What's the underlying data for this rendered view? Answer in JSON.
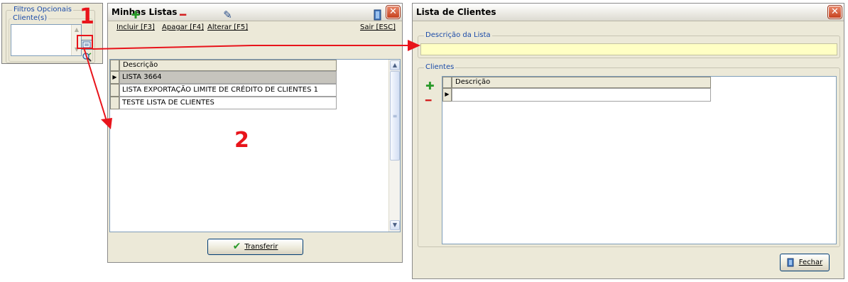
{
  "filter_panel": {
    "group_title": "Filtros Opcionais",
    "clients_label": "Cliente(s)"
  },
  "markers": {
    "one": "1",
    "two": "2"
  },
  "minhas_listas": {
    "title": "Minhas Listas",
    "toolbar": {
      "incluir": "Incluir [F3]",
      "apagar": "Apagar [F4]",
      "alterar": "Alterar [F5]",
      "sair": "Sair [ESC]"
    },
    "grid_header": "Descrição",
    "rows": [
      "LISTA 3664",
      "LISTA EXPORTAÇÃO LIMITE DE CRÉDITO DE CLIENTES 1",
      "TESTE LISTA DE CLIENTES"
    ],
    "transfer_button": "Transferir"
  },
  "lista_clientes": {
    "title": "Lista de Clientes",
    "descricao_group": "Descrição da Lista",
    "descricao_value": "",
    "clientes_group": "Clientes",
    "grid_header": "Descrição",
    "close_button": "Fechar"
  },
  "colors": {
    "marker_red": "#e8141b",
    "group_title_blue": "#1a4aa8",
    "input_highlight": "#ffffc4",
    "window_face": "#ece9d8"
  },
  "icons": {
    "add": "plus-icon",
    "delete": "minus-icon",
    "edit": "pencil-icon",
    "exit": "door-icon",
    "search": "search-icon",
    "confirm": "checkmark-icon"
  }
}
